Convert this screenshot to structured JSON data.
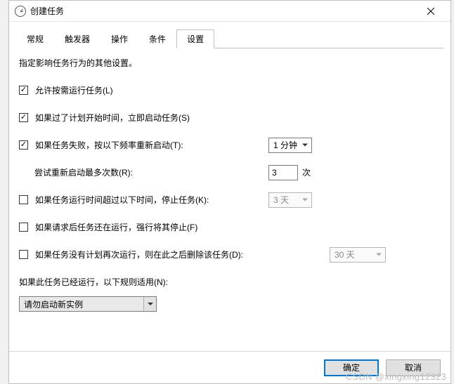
{
  "title": "创建任务",
  "tabs": [
    "常规",
    "触发器",
    "操作",
    "条件",
    "设置"
  ],
  "active_tab_index": 4,
  "description": "指定影响任务行为的其他设置。",
  "settings": {
    "allow_on_demand": {
      "checked": true,
      "label": "允许按需运行任务(L)"
    },
    "run_asap_if_missed": {
      "checked": true,
      "label": "如果过了计划开始时间，立即启动任务(S)"
    },
    "restart_on_fail": {
      "checked": true,
      "label": "如果任务失败，按以下频率重新启动(T):",
      "interval": "1 分钟"
    },
    "restart_attempts": {
      "label": "尝试重新启动最多次数(R):",
      "value": "3",
      "suffix": "次"
    },
    "stop_if_longer": {
      "checked": false,
      "label": "如果任务运行时间超过以下时间，停止任务(K):",
      "value": "3 天",
      "enabled": false
    },
    "force_stop": {
      "checked": false,
      "label": "如果请求后任务还在运行，强行将其停止(F)"
    },
    "delete_if_not_scheduled": {
      "checked": false,
      "label": "如果任务没有计划再次运行，则在此之后删除该任务(D):",
      "value": "30 天",
      "enabled": false
    },
    "if_already_running_label": "如果此任务已经运行，以下规则适用(N):",
    "if_already_running_value": "请勿启动新实例"
  },
  "buttons": {
    "ok": "确定",
    "cancel": "取消"
  },
  "watermark": "CSDN @xingxing12323"
}
